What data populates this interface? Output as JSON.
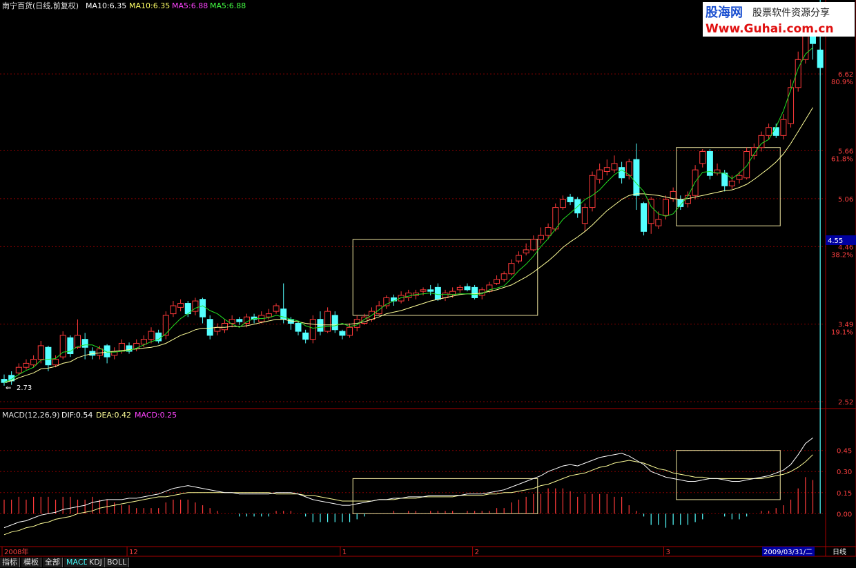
{
  "header": {
    "stock": "南宁百货(日线,前复权)",
    "items": [
      {
        "text": "MA10:6.35",
        "color": "#ffffff"
      },
      {
        "text": "MA10:6.35",
        "color": "#ffff66"
      },
      {
        "text": "MA5:6.88",
        "color": "#ff44ff"
      },
      {
        "text": "MA5:6.88",
        "color": "#44ff44"
      }
    ]
  },
  "watermark": {
    "line1": "股海网",
    "line1b": "股票软件资源分享",
    "line2": "Www.Guhai.com.cn"
  },
  "macd_header": {
    "label": "MACD(12,26,9)",
    "dif": "DIF:0.54",
    "dea": "DEA:0.42",
    "macd": "MACD:0.25"
  },
  "colors": {
    "up": "#ff3a3a",
    "down": "#54ffff",
    "ma_fast": "#22dd22",
    "ma_slow": "#ffff99",
    "dif": "#ffffff",
    "dea": "#ffff99",
    "box": "#f0e6a0",
    "grid": "#880000",
    "axis_text": "#ff4040"
  },
  "price_labels": [
    {
      "price": "6.62",
      "pct": "80.9%"
    },
    {
      "price": "5.66",
      "pct": "61.8%"
    },
    {
      "price": "5.06",
      "pct": ""
    },
    {
      "price": "4.46",
      "pct": "38.2%"
    },
    {
      "price": "3.49",
      "pct": "19.1%"
    },
    {
      "price": "2.52",
      "pct": ""
    }
  ],
  "current_price": "4.55",
  "low_marker": "2.73",
  "macd_labels": [
    "0.45",
    "0.30",
    "0.15",
    "0.00"
  ],
  "date_axis": {
    "labels": [
      "2008年",
      "12",
      "1",
      "2",
      "3"
    ],
    "current": "2009/03/31/二",
    "period": "日线"
  },
  "bottom_tabs": [
    {
      "label": "指标",
      "active": false
    },
    {
      "label": "模板",
      "active": false
    },
    {
      "label": "全部",
      "active": false
    },
    {
      "label": "MACD",
      "active": true
    },
    {
      "label": "KDJ",
      "active": false
    },
    {
      "label": "BOLL",
      "active": false
    }
  ],
  "chart_data": {
    "type": "candlestick",
    "price_range": [
      2.52,
      7.2
    ],
    "macd_range": [
      -0.2,
      0.65
    ],
    "candles": [
      [
        2.8,
        2.76,
        2.86,
        2.72
      ],
      [
        2.85,
        2.78,
        2.9,
        2.73
      ],
      [
        2.88,
        2.95,
        3.0,
        2.85
      ],
      [
        2.95,
        3.0,
        3.05,
        2.92
      ],
      [
        2.98,
        3.05,
        3.1,
        2.95
      ],
      [
        3.05,
        3.22,
        3.28,
        3.0
      ],
      [
        3.2,
        2.98,
        3.22,
        2.9
      ],
      [
        2.98,
        3.05,
        3.1,
        2.95
      ],
      [
        3.08,
        3.35,
        3.4,
        3.05
      ],
      [
        3.32,
        3.12,
        3.35,
        3.08
      ],
      [
        3.2,
        3.35,
        3.55,
        3.18
      ],
      [
        3.3,
        3.2,
        3.38,
        3.05
      ],
      [
        3.15,
        3.1,
        3.2,
        3.05
      ],
      [
        3.1,
        3.18,
        3.22,
        3.05
      ],
      [
        3.22,
        3.08,
        3.24,
        3.0
      ],
      [
        3.1,
        3.15,
        3.2,
        3.05
      ],
      [
        3.15,
        3.25,
        3.3,
        3.12
      ],
      [
        3.22,
        3.15,
        3.26,
        3.12
      ],
      [
        3.18,
        3.25,
        3.3,
        3.15
      ],
      [
        3.24,
        3.3,
        3.35,
        3.2
      ],
      [
        3.3,
        3.4,
        3.45,
        3.25
      ],
      [
        3.38,
        3.28,
        3.42,
        3.25
      ],
      [
        3.35,
        3.6,
        3.65,
        3.3
      ],
      [
        3.62,
        3.72,
        3.78,
        3.58
      ],
      [
        3.7,
        3.75,
        3.8,
        3.65
      ],
      [
        3.75,
        3.62,
        3.78,
        3.58
      ],
      [
        3.65,
        3.78,
        3.82,
        3.6
      ],
      [
        3.8,
        3.58,
        3.82,
        3.5
      ],
      [
        3.55,
        3.35,
        3.6,
        3.3
      ],
      [
        3.4,
        3.45,
        3.5,
        3.35
      ],
      [
        3.42,
        3.5,
        3.55,
        3.38
      ],
      [
        3.5,
        3.55,
        3.6,
        3.45
      ],
      [
        3.55,
        3.52,
        3.58,
        3.48
      ],
      [
        3.5,
        3.58,
        3.62,
        3.45
      ],
      [
        3.58,
        3.55,
        3.62,
        3.5
      ],
      [
        3.52,
        3.6,
        3.65,
        3.5
      ],
      [
        3.58,
        3.62,
        3.68,
        3.55
      ],
      [
        3.65,
        3.72,
        3.75,
        3.62
      ],
      [
        3.68,
        3.55,
        4.0,
        3.5
      ],
      [
        3.55,
        3.5,
        3.58,
        3.42
      ],
      [
        3.5,
        3.4,
        3.52,
        3.35
      ],
      [
        3.38,
        3.3,
        3.42,
        3.25
      ],
      [
        3.3,
        3.55,
        3.6,
        3.25
      ],
      [
        3.55,
        3.4,
        3.65,
        3.35
      ],
      [
        3.4,
        3.65,
        3.7,
        3.38
      ],
      [
        3.6,
        3.42,
        3.65,
        3.38
      ],
      [
        3.4,
        3.35,
        3.42,
        3.3
      ],
      [
        3.35,
        3.45,
        3.5,
        3.32
      ],
      [
        3.45,
        3.55,
        3.6,
        3.4
      ],
      [
        3.5,
        3.58,
        3.62,
        3.48
      ],
      [
        3.55,
        3.65,
        3.7,
        3.52
      ],
      [
        3.62,
        3.72,
        3.78,
        3.6
      ],
      [
        3.72,
        3.82,
        3.85,
        3.68
      ],
      [
        3.82,
        3.78,
        3.86,
        3.72
      ],
      [
        3.78,
        3.85,
        3.9,
        3.75
      ],
      [
        3.82,
        3.88,
        3.92,
        3.78
      ],
      [
        3.85,
        3.88,
        3.92,
        3.8
      ],
      [
        3.9,
        3.92,
        3.95,
        3.85
      ],
      [
        3.92,
        3.9,
        3.98,
        3.85
      ],
      [
        3.95,
        3.8,
        4.0,
        3.78
      ],
      [
        3.82,
        3.88,
        3.92,
        3.78
      ],
      [
        3.86,
        3.9,
        3.95,
        3.82
      ],
      [
        3.92,
        3.95,
        3.98,
        3.88
      ],
      [
        3.96,
        3.92,
        4.0,
        3.9
      ],
      [
        3.95,
        3.82,
        3.98,
        3.8
      ],
      [
        3.85,
        3.92,
        3.95,
        3.8
      ],
      [
        3.9,
        3.98,
        4.02,
        3.88
      ],
      [
        4.0,
        4.05,
        4.1,
        3.98
      ],
      [
        4.05,
        4.12,
        4.15,
        4.02
      ],
      [
        4.12,
        4.25,
        4.3,
        4.1
      ],
      [
        4.28,
        4.35,
        4.4,
        4.25
      ],
      [
        4.38,
        4.42,
        4.5,
        4.35
      ],
      [
        4.42,
        4.55,
        4.6,
        4.4
      ],
      [
        4.55,
        4.6,
        4.7,
        4.5
      ],
      [
        4.6,
        4.7,
        4.75,
        4.55
      ],
      [
        4.68,
        4.95,
        5.0,
        4.65
      ],
      [
        4.95,
        5.05,
        5.1,
        4.92
      ],
      [
        5.08,
        5.02,
        5.12,
        4.98
      ],
      [
        5.05,
        4.88,
        5.08,
        4.82
      ],
      [
        4.75,
        4.95,
        5.0,
        4.65
      ],
      [
        4.95,
        5.35,
        5.4,
        4.9
      ],
      [
        5.3,
        5.42,
        5.5,
        5.25
      ],
      [
        5.4,
        5.45,
        5.55,
        5.35
      ],
      [
        5.42,
        5.5,
        5.6,
        5.38
      ],
      [
        5.45,
        5.32,
        5.52,
        5.25
      ],
      [
        5.35,
        5.52,
        5.56,
        5.3
      ],
      [
        5.55,
        5.1,
        5.75,
        4.92
      ],
      [
        5.0,
        4.65,
        5.02,
        4.6
      ],
      [
        4.75,
        5.05,
        5.08,
        4.62
      ],
      [
        4.72,
        4.8,
        4.9,
        4.68
      ],
      [
        4.85,
        5.05,
        5.1,
        4.8
      ],
      [
        5.06,
        5.15,
        5.2,
        5.02
      ],
      [
        5.05,
        4.96,
        5.1,
        4.92
      ],
      [
        5.0,
        5.1,
        5.15,
        4.95
      ],
      [
        5.1,
        5.42,
        5.48,
        5.05
      ],
      [
        5.5,
        5.65,
        5.68,
        5.45
      ],
      [
        5.65,
        5.35,
        5.68,
        5.3
      ],
      [
        5.38,
        5.42,
        5.5,
        5.35
      ],
      [
        5.38,
        5.22,
        5.42,
        5.15
      ],
      [
        5.22,
        5.28,
        5.35,
        5.18
      ],
      [
        5.3,
        5.35,
        5.4,
        5.25
      ],
      [
        5.32,
        5.65,
        5.7,
        5.3
      ],
      [
        5.6,
        5.7,
        5.75,
        5.55
      ],
      [
        5.7,
        5.85,
        5.9,
        5.65
      ],
      [
        5.85,
        5.95,
        6.0,
        5.8
      ],
      [
        5.95,
        5.85,
        6.0,
        5.82
      ],
      [
        5.85,
        6.05,
        6.12,
        5.8
      ],
      [
        6.0,
        6.45,
        6.55,
        5.95
      ],
      [
        6.45,
        6.8,
        6.9,
        6.4
      ],
      [
        6.8,
        7.2,
        7.3,
        6.75
      ],
      [
        7.2,
        7.0,
        7.25,
        6.8
      ],
      [
        6.92,
        6.7,
        6.95,
        6.6
      ]
    ],
    "ma_fast": [
      2.76,
      2.8,
      2.86,
      2.91,
      2.95,
      3.04,
      3.05,
      3.06,
      3.14,
      3.15,
      3.21,
      3.23,
      3.23,
      3.19,
      3.14,
      3.14,
      3.15,
      3.16,
      3.19,
      3.23,
      3.27,
      3.3,
      3.37,
      3.47,
      3.56,
      3.62,
      3.69,
      3.72,
      3.66,
      3.62,
      3.55,
      3.49,
      3.45,
      3.52,
      3.56,
      3.56,
      3.57,
      3.6,
      3.58,
      3.55,
      3.53,
      3.47,
      3.44,
      3.45,
      3.46,
      3.47,
      3.5,
      3.46,
      3.48,
      3.55,
      3.6,
      3.67,
      3.74,
      3.78,
      3.82,
      3.84,
      3.86,
      3.87,
      3.88,
      3.86,
      3.86,
      3.86,
      3.87,
      3.87,
      3.86,
      3.87,
      3.92,
      3.94,
      3.97,
      4.06,
      4.16,
      4.24,
      4.34,
      4.46,
      4.56,
      4.68,
      4.8,
      4.88,
      4.96,
      5.05,
      5.1,
      5.17,
      5.27,
      5.36,
      5.42,
      5.36,
      5.25,
      5.15,
      4.96,
      4.87,
      4.84,
      4.87,
      4.98,
      5.09,
      5.27,
      5.39,
      5.4,
      5.38,
      5.38,
      5.31,
      5.38,
      5.47,
      5.62,
      5.75,
      5.8,
      5.96,
      6.16,
      6.42,
      6.69,
      6.87,
      6.95
    ],
    "ma_slow": [
      2.76,
      2.78,
      2.82,
      2.85,
      2.88,
      2.93,
      2.94,
      2.96,
      3.0,
      3.02,
      3.07,
      3.1,
      3.12,
      3.13,
      3.14,
      3.15,
      3.16,
      3.17,
      3.18,
      3.19,
      3.2,
      3.22,
      3.25,
      3.3,
      3.35,
      3.38,
      3.42,
      3.44,
      3.44,
      3.45,
      3.45,
      3.46,
      3.46,
      3.47,
      3.49,
      3.51,
      3.53,
      3.55,
      3.55,
      3.53,
      3.52,
      3.5,
      3.49,
      3.48,
      3.48,
      3.48,
      3.49,
      3.49,
      3.5,
      3.52,
      3.55,
      3.58,
      3.62,
      3.64,
      3.66,
      3.69,
      3.72,
      3.75,
      3.78,
      3.8,
      3.82,
      3.84,
      3.86,
      3.87,
      3.87,
      3.88,
      3.9,
      3.92,
      3.95,
      3.98,
      4.03,
      4.08,
      4.14,
      4.21,
      4.28,
      4.36,
      4.45,
      4.52,
      4.58,
      4.65,
      4.73,
      4.82,
      4.91,
      4.98,
      5.05,
      5.1,
      5.12,
      5.12,
      5.11,
      5.1,
      5.08,
      5.06,
      5.05,
      5.06,
      5.08,
      5.1,
      5.12,
      5.14,
      5.16,
      5.17,
      5.2,
      5.24,
      5.3,
      5.37,
      5.44,
      5.52,
      5.62,
      5.75,
      5.9,
      6.05,
      6.2
    ],
    "dif": [
      -0.1,
      -0.08,
      -0.06,
      -0.05,
      -0.03,
      -0.01,
      0.0,
      0.01,
      0.03,
      0.04,
      0.05,
      0.06,
      0.08,
      0.09,
      0.1,
      0.1,
      0.1,
      0.11,
      0.11,
      0.12,
      0.13,
      0.14,
      0.16,
      0.18,
      0.19,
      0.2,
      0.19,
      0.18,
      0.17,
      0.16,
      0.15,
      0.15,
      0.14,
      0.14,
      0.14,
      0.14,
      0.14,
      0.15,
      0.15,
      0.15,
      0.14,
      0.12,
      0.1,
      0.09,
      0.08,
      0.07,
      0.06,
      0.06,
      0.07,
      0.08,
      0.09,
      0.1,
      0.1,
      0.11,
      0.11,
      0.12,
      0.12,
      0.12,
      0.13,
      0.13,
      0.13,
      0.13,
      0.13,
      0.14,
      0.14,
      0.14,
      0.15,
      0.16,
      0.17,
      0.19,
      0.21,
      0.23,
      0.25,
      0.27,
      0.3,
      0.32,
      0.34,
      0.35,
      0.34,
      0.36,
      0.38,
      0.4,
      0.41,
      0.42,
      0.43,
      0.41,
      0.38,
      0.35,
      0.3,
      0.28,
      0.26,
      0.25,
      0.24,
      0.23,
      0.23,
      0.24,
      0.25,
      0.25,
      0.24,
      0.23,
      0.23,
      0.24,
      0.25,
      0.26,
      0.27,
      0.29,
      0.31,
      0.35,
      0.42,
      0.5,
      0.54
    ],
    "dea": [
      -0.15,
      -0.13,
      -0.12,
      -0.1,
      -0.09,
      -0.07,
      -0.06,
      -0.04,
      -0.03,
      -0.02,
      0.0,
      0.01,
      0.02,
      0.04,
      0.05,
      0.06,
      0.07,
      0.08,
      0.09,
      0.1,
      0.11,
      0.12,
      0.12,
      0.13,
      0.14,
      0.15,
      0.15,
      0.15,
      0.15,
      0.15,
      0.15,
      0.15,
      0.15,
      0.15,
      0.15,
      0.15,
      0.15,
      0.14,
      0.14,
      0.14,
      0.14,
      0.13,
      0.13,
      0.12,
      0.11,
      0.1,
      0.09,
      0.09,
      0.09,
      0.09,
      0.09,
      0.1,
      0.1,
      0.1,
      0.11,
      0.11,
      0.11,
      0.12,
      0.12,
      0.12,
      0.12,
      0.12,
      0.13,
      0.13,
      0.13,
      0.13,
      0.14,
      0.14,
      0.15,
      0.15,
      0.16,
      0.17,
      0.18,
      0.2,
      0.21,
      0.23,
      0.25,
      0.27,
      0.28,
      0.29,
      0.31,
      0.33,
      0.34,
      0.36,
      0.37,
      0.38,
      0.37,
      0.36,
      0.34,
      0.32,
      0.31,
      0.29,
      0.28,
      0.27,
      0.26,
      0.26,
      0.25,
      0.25,
      0.25,
      0.25,
      0.25,
      0.25,
      0.25,
      0.25,
      0.26,
      0.27,
      0.28,
      0.3,
      0.33,
      0.37,
      0.42
    ],
    "boxes": [
      {
        "from": 48,
        "to": 72,
        "price_top": 4.55,
        "price_bottom": 3.6
      },
      {
        "from": 92,
        "to": 105,
        "price_top": 5.7,
        "price_bottom": 4.72
      }
    ],
    "macd_boxes": [
      {
        "from": 48,
        "to": 72,
        "top": 0.25,
        "bottom": 0.0
      },
      {
        "from": 92,
        "to": 105,
        "top": 0.45,
        "bottom": 0.1
      }
    ],
    "date_positions": [
      0,
      17,
      46,
      64,
      90
    ]
  }
}
